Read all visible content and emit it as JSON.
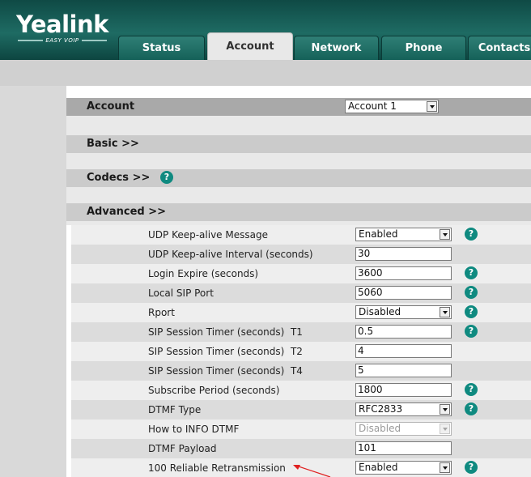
{
  "header": {
    "logo": "Yealink",
    "logo_tagline": "EASY VOIP",
    "tabs": [
      {
        "label": "Status"
      },
      {
        "label": "Account"
      },
      {
        "label": "Network"
      },
      {
        "label": "Phone"
      },
      {
        "label": "Contacts"
      }
    ]
  },
  "account": {
    "title": "Account",
    "selected": "Account 1"
  },
  "sections": {
    "basic": "Basic >>",
    "codecs": "Codecs >>",
    "advanced": "Advanced >>"
  },
  "advanced": {
    "rows": [
      {
        "label": "UDP Keep-alive Message",
        "value": "Enabled",
        "type": "select"
      },
      {
        "label": "UDP Keep-alive Interval (seconds)",
        "value": "30",
        "type": "input"
      },
      {
        "label": "Login Expire (seconds)",
        "value": "3600",
        "type": "input"
      },
      {
        "label": "Local SIP Port",
        "value": "5060",
        "type": "input"
      },
      {
        "label": "Rport",
        "value": "Disabled",
        "type": "select"
      },
      {
        "label": "SIP Session Timer (seconds)  T1",
        "value": "0.5",
        "type": "input"
      },
      {
        "label": "SIP Session Timer (seconds)  T2",
        "value": "4",
        "type": "input"
      },
      {
        "label": "SIP Session Timer (seconds)  T4",
        "value": "5",
        "type": "input"
      },
      {
        "label": "Subscribe Period (seconds)",
        "value": "1800",
        "type": "input"
      },
      {
        "label": "DTMF Type",
        "value": "RFC2833",
        "type": "select"
      },
      {
        "label": "How to INFO DTMF",
        "value": "Disabled",
        "type": "select",
        "disabled": true
      },
      {
        "label": "DTMF Payload",
        "value": "101",
        "type": "input"
      },
      {
        "label": "100 Reliable Retransmission",
        "value": "Enabled",
        "type": "select"
      }
    ]
  },
  "icons": {
    "help": "help-icon",
    "dropdown": "chevron-down-icon"
  },
  "colors": {
    "header": "#1e6b63",
    "help_icon": "#0f8a80",
    "annotation_arrow": "#e02020"
  }
}
